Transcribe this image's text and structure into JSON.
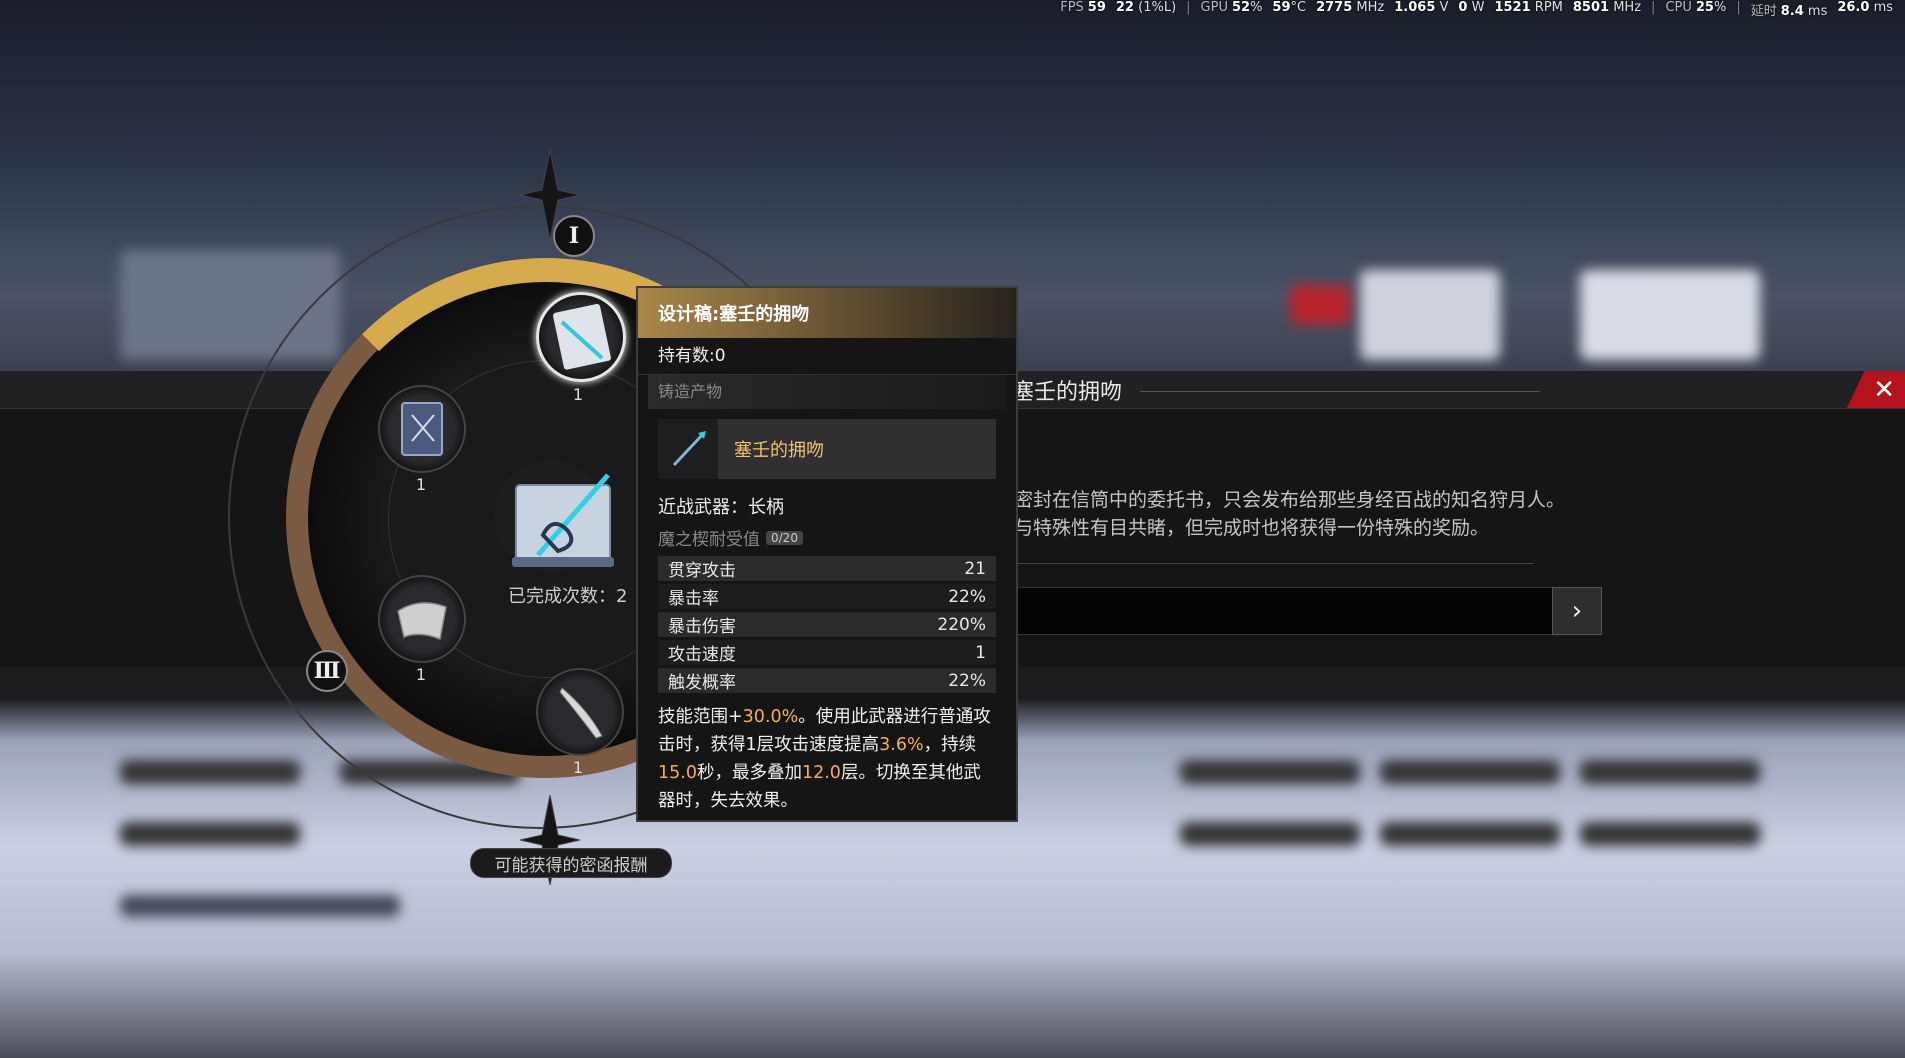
{
  "perf": {
    "fps_label": "FPS",
    "fps": "59",
    "fps_low": "22",
    "fps_low_unit": "(1%L)",
    "gpu_label": "GPU",
    "gpu_load": "52",
    "gpu_load_unit": "%",
    "gpu_temp": "59",
    "gpu_temp_unit": "°C",
    "gpu_clock": "2775",
    "gpu_clock_unit": "MHz",
    "gpu_volt": "1.065",
    "gpu_volt_unit": "V",
    "gpu_power": "0",
    "gpu_power_unit": "W",
    "fan": "1521",
    "fan_unit": "RPM",
    "mem_clock": "8501",
    "mem_clock_unit": "MHz",
    "cpu_label": "CPU",
    "cpu_load": "25",
    "cpu_load_unit": "%",
    "latency_label": "延时",
    "latency1": "8.4",
    "latency1_unit": "ms",
    "latency2": "26.0",
    "latency2_unit": "ms",
    "sep": "|"
  },
  "wheel": {
    "roman_top": "Ⅰ",
    "roman_left": "Ⅲ",
    "items": [
      {
        "count": "1",
        "icon": "blueprint-icon"
      },
      {
        "count": "1",
        "icon": "book-icon"
      },
      {
        "count": "1",
        "icon": "cloth-icon"
      },
      {
        "count": "1",
        "icon": "blade-icon"
      }
    ],
    "completed_label": "已完成次数：2",
    "reward_label": "可能获得的密函报酬"
  },
  "tooltip": {
    "title": "设计稿:塞壬的拥吻",
    "owned": "持有数:0",
    "section": "铸造产物",
    "product_name": "塞壬的拥吻",
    "weapon_type": "近战武器：长柄",
    "durability_label": "魔之楔耐受值",
    "durability_value": "0/20",
    "stats": [
      {
        "name": "贯穿攻击",
        "value": "21"
      },
      {
        "name": "暴击率",
        "value": "22%"
      },
      {
        "name": "暴击伤害",
        "value": "220%"
      },
      {
        "name": "攻击速度",
        "value": "1"
      },
      {
        "name": "触发概率",
        "value": "22%"
      }
    ],
    "skill": {
      "p1": "技能范围+",
      "v1": "30.0%",
      "p2": "。使用此武器进行普通攻击时，获得1层攻击速度提高",
      "v2": "3.6%",
      "p3": "，持续",
      "v3": "15.0",
      "p4": "秒，最多叠加",
      "v4": "12.0",
      "p5": "层。切换至其他武器时，失去效果。"
    }
  },
  "panel": {
    "title": "塞壬的拥吻",
    "desc1": "密封在信筒中的委托书，只会发布给那些身经百战的知名狩月人。",
    "desc2": "与特殊性有目共睹，但完成时也将获得一份特殊的奖励。",
    "next": "›",
    "close": "✕"
  },
  "colors": {
    "accent": "#f1b24a",
    "gold": "#d5ab4e",
    "close": "#b3141b"
  }
}
